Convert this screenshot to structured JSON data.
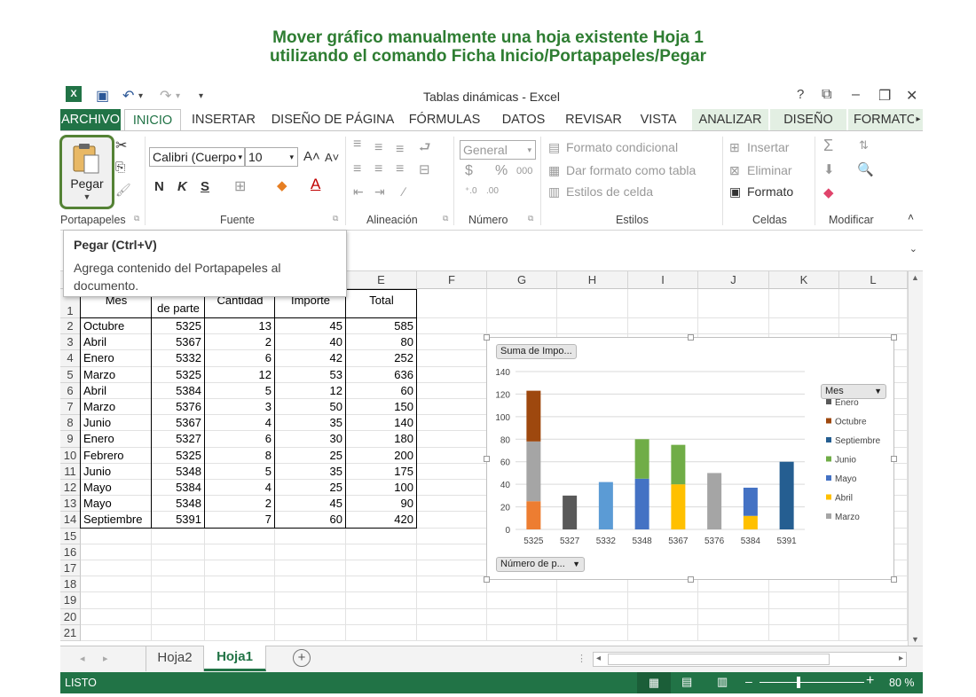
{
  "heading": {
    "line1": "Mover gráfico manualmente una hoja existente Hoja 1",
    "line2": "utilizando el comando Ficha Inicio/Portapapeles/Pegar"
  },
  "window": {
    "title": "Tablas dinámicas - Excel",
    "help": "?",
    "tabs": [
      "ARCHIVO",
      "INICIO",
      "INSERTAR",
      "DISEÑO DE PÁGINA",
      "FÓRMULAS",
      "DATOS",
      "REVISAR",
      "VISTA",
      "ANALIZAR",
      "DISEÑO",
      "FORMATO"
    ]
  },
  "ribbon": {
    "paste_label": "Pegar",
    "font_name": "Calibri (Cuerpo",
    "font_size": "10",
    "bold": "N",
    "italic": "K",
    "underline": "S",
    "number_format": "General",
    "currency": "$",
    "percent": "%",
    "thousands": "000",
    "cond_format": "Formato condicional",
    "table_format": "Dar formato como tabla",
    "cell_styles": "Estilos de celda",
    "insert": "Insertar",
    "delete": "Eliminar",
    "format": "Formato",
    "groups": [
      "Portapapeles",
      "Fuente",
      "Alineación",
      "Número",
      "Estilos",
      "Celdas",
      "Modificar"
    ]
  },
  "tooltip": {
    "title": "Pegar (Ctrl+V)",
    "body": "Agrega contenido del Portapapeles al documento."
  },
  "grid": {
    "columns": [
      "E",
      "F",
      "G",
      "H",
      "I",
      "J",
      "K",
      "L"
    ],
    "rows": [
      "1",
      "2",
      "3",
      "4",
      "5",
      "6",
      "7",
      "8",
      "9",
      "10",
      "11",
      "12",
      "13",
      "14",
      "15",
      "16",
      "17",
      "18",
      "19",
      "20",
      "21"
    ],
    "headers": [
      "Mes",
      "de parte",
      "Cantidad",
      "Importe",
      "Total"
    ],
    "data": [
      [
        "Octubre",
        "5325",
        "13",
        "45",
        "585"
      ],
      [
        "Abril",
        "5367",
        "2",
        "40",
        "80"
      ],
      [
        "Enero",
        "5332",
        "6",
        "42",
        "252"
      ],
      [
        "Marzo",
        "5325",
        "12",
        "53",
        "636"
      ],
      [
        "Abril",
        "5384",
        "5",
        "12",
        "60"
      ],
      [
        "Marzo",
        "5376",
        "3",
        "50",
        "150"
      ],
      [
        "Junio",
        "5367",
        "4",
        "35",
        "140"
      ],
      [
        "Enero",
        "5327",
        "6",
        "30",
        "180"
      ],
      [
        "Febrero",
        "5325",
        "8",
        "25",
        "200"
      ],
      [
        "Junio",
        "5348",
        "5",
        "35",
        "175"
      ],
      [
        "Mayo",
        "5384",
        "4",
        "25",
        "100"
      ],
      [
        "Mayo",
        "5348",
        "2",
        "45",
        "90"
      ],
      [
        "Septiembre",
        "5391",
        "7",
        "60",
        "420"
      ]
    ]
  },
  "chart_data": {
    "type": "bar",
    "stacked": true,
    "value_field_button": "Suma de Impo...",
    "axis_field_button": "Número de p...",
    "legend_field_button": "Mes",
    "categories": [
      "5325",
      "5327",
      "5332",
      "5348",
      "5367",
      "5376",
      "5384",
      "5391"
    ],
    "ylim": [
      0,
      140
    ],
    "yticks": [
      "0",
      "20",
      "40",
      "60",
      "80",
      "100",
      "120",
      "140"
    ],
    "legend_position": "right",
    "series": [
      {
        "name": "Enero",
        "color": "#595959",
        "values": [
          0,
          30,
          0,
          0,
          0,
          0,
          0,
          0
        ]
      },
      {
        "name": "Octubre",
        "color": "#9e480e",
        "values": [
          45,
          0,
          0,
          0,
          0,
          0,
          0,
          0
        ]
      },
      {
        "name": "Septiembre",
        "color": "#255e91",
        "values": [
          0,
          0,
          0,
          0,
          0,
          0,
          0,
          60
        ]
      },
      {
        "name": "Junio",
        "color": "#70ad47",
        "values": [
          0,
          0,
          0,
          35,
          35,
          0,
          0,
          0
        ]
      },
      {
        "name": "Mayo",
        "color": "#4472c4",
        "values": [
          0,
          0,
          0,
          45,
          0,
          0,
          25,
          0
        ]
      },
      {
        "name": "Abril",
        "color": "#ffc000",
        "values": [
          0,
          0,
          0,
          0,
          40,
          0,
          12,
          0
        ]
      },
      {
        "name": "Marzo",
        "color": "#a5a5a5",
        "values": [
          53,
          0,
          0,
          0,
          0,
          50,
          0,
          0
        ]
      },
      {
        "name": "",
        "color": "#ed7d31",
        "values": [
          25,
          0,
          0,
          0,
          0,
          0,
          0,
          0
        ]
      },
      {
        "name": "",
        "color": "#5b9bd5",
        "values": [
          0,
          0,
          42,
          0,
          0,
          0,
          0,
          0
        ]
      }
    ]
  },
  "sheets": [
    "Hoja2",
    "Hoja1"
  ],
  "status": {
    "mode": "LISTO",
    "zoom": "80 %"
  }
}
